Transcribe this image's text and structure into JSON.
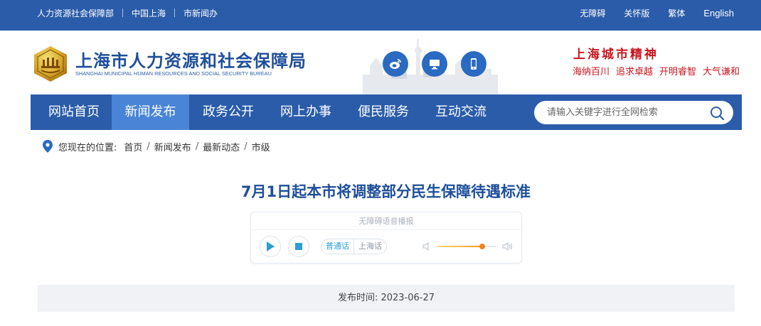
{
  "topbar": {
    "left_links": [
      "人力资源社会保障部",
      "中国上海",
      "市新闻办"
    ],
    "right_links": [
      "无障碍",
      "关怀版",
      "繁体",
      "English"
    ]
  },
  "header": {
    "title": "上海市人力资源和社会保障局",
    "subtitle_en": "SHANGHAI MUNICIPAL HUMAN RESOURCES AND SOCIAL SECURITY BUREAU",
    "social_icons": [
      "weibo-icon",
      "computer-icon",
      "mobile-icon"
    ],
    "spirit_title": "上海城市精神",
    "spirit_words": [
      "海纳百川",
      "追求卓越",
      "开明睿智",
      "大气谦和"
    ]
  },
  "nav": {
    "items": [
      "网站首页",
      "新闻发布",
      "政务公开",
      "网上办事",
      "便民服务",
      "互动交流"
    ],
    "active": "新闻发布",
    "search_placeholder": "请输入关键字进行全网检索"
  },
  "breadcrumb": {
    "label": "您现在的位置:",
    "items": [
      "首页",
      "新闻发布",
      "最新动态",
      "市级"
    ]
  },
  "article": {
    "title": "7月1日起本市将调整部分民生保障待遇标准",
    "publish_text": "发布时间: 2023-06-27"
  },
  "player": {
    "hint": "无障碍语音播报",
    "languages": [
      "普通话",
      "上海话"
    ],
    "selected_language": "普通话",
    "volume_fraction": 0.77
  },
  "colors": {
    "primary": "#2a5caa",
    "nav_active": "#4a84d6",
    "title_blue": "#1e4f9a",
    "spirit_red": "#c8161d",
    "accent_orange": "#f0841c"
  }
}
